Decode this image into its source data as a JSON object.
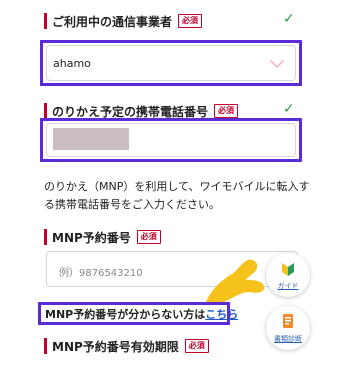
{
  "carrier_section": {
    "label": "ご利用中の通信事業者",
    "required_badge": "必須",
    "selected_value": "ahamo"
  },
  "phone_section": {
    "label": "のりかえ予定の携帯電話番号",
    "required_badge": "必須"
  },
  "description": "のりかえ（MNP）を利用して、ワイモバイルに転入する携帯電話番号をご入力ください。",
  "mnp_section": {
    "label": "MNP予約番号",
    "required_badge": "必須",
    "placeholder": "例）9876543210"
  },
  "help_link": {
    "text": "MNP予約番号が分からない方は",
    "link_text": "こちら"
  },
  "expiry_section": {
    "label": "MNP予約番号有効期限",
    "required_badge": "必須"
  },
  "floating": {
    "guide_label": "ガイド",
    "docs_label": "書類診断"
  },
  "colors": {
    "accent_red": "#c4002b",
    "highlight_purple": "#5b2bd6",
    "check_green": "#2e9b54",
    "link_blue": "#1f56c4",
    "pointer_yellow": "#f4c21b"
  }
}
